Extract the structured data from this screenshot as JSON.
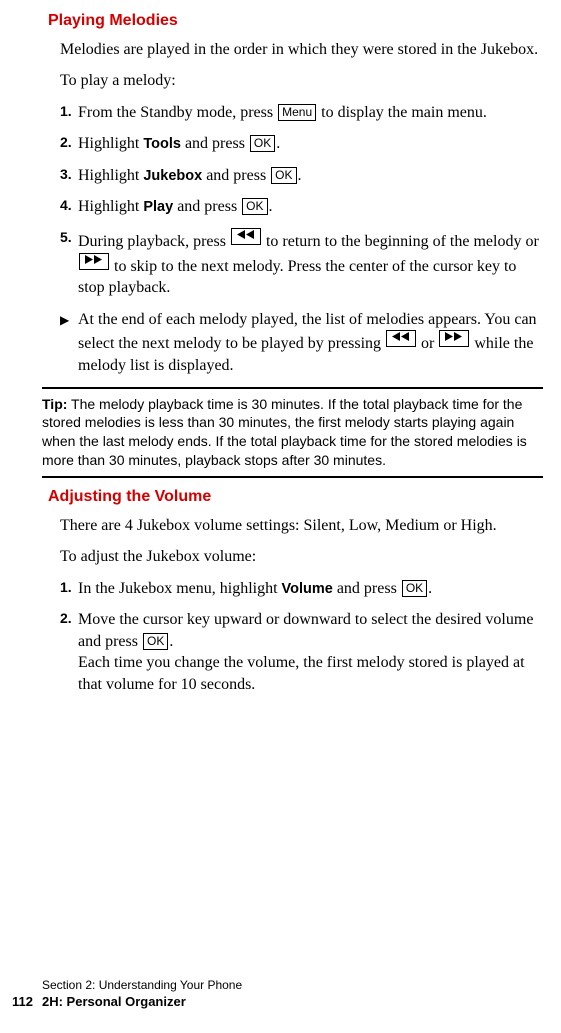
{
  "section1": {
    "title": "Playing Melodies",
    "p1": "Melodies are played in the order in which they were stored in the Jukebox.",
    "p2": "To play a melody:",
    "steps": {
      "s1": {
        "num": "1.",
        "a": "From the Standby mode, press ",
        "key": "Menu",
        "b": " to display the main menu."
      },
      "s2": {
        "num": "2.",
        "a": "Highlight ",
        "bold": "Tools",
        "b": " and press ",
        "key": "OK",
        "c": "."
      },
      "s3": {
        "num": "3.",
        "a": "Highlight ",
        "bold": "Jukebox",
        "b": " and press ",
        "key": "OK",
        "c": "."
      },
      "s4": {
        "num": "4.",
        "a": "Highlight ",
        "bold": "Play",
        "b": " and press ",
        "key": "OK",
        "c": "."
      },
      "s5": {
        "num": "5.",
        "a": "During playback, press ",
        "b": " to return to the beginning of the melody or ",
        "c": " to skip to the next melody. Press the center of the cursor key to stop playback."
      }
    },
    "note": {
      "a": "At the end of each melody played, the list of melodies appears. You can select the next melody to be played by pressing ",
      "b": " or ",
      "c": " while the melody list is displayed."
    }
  },
  "tip": {
    "label": "Tip:",
    "text": " The melody playback time is 30 minutes. If the total playback time for the stored melodies is less than 30 minutes, the first melody starts playing again when the last melody ends. If the total playback time for the stored melodies is more than 30 minutes, playback stops after 30 minutes."
  },
  "section2": {
    "title": "Adjusting the Volume",
    "p1": "There are 4 Jukebox volume settings: Silent, Low, Medium or High.",
    "p2": "To adjust the Jukebox volume:",
    "steps": {
      "s1": {
        "num": "1.",
        "a": "In the Jukebox menu, highlight ",
        "bold": "Volume",
        "b": " and press ",
        "key": "OK",
        "c": "."
      },
      "s2": {
        "num": "2.",
        "a": "Move the cursor key upward or downward to select the desired volume and press ",
        "key": "OK",
        "b": ".",
        "c": "Each time you change the volume, the first melody stored is played at that volume for 10 seconds."
      }
    }
  },
  "footer": {
    "l1": "Section 2: Understanding Your Phone",
    "l2": "2H: Personal Organizer",
    "page": "112"
  }
}
